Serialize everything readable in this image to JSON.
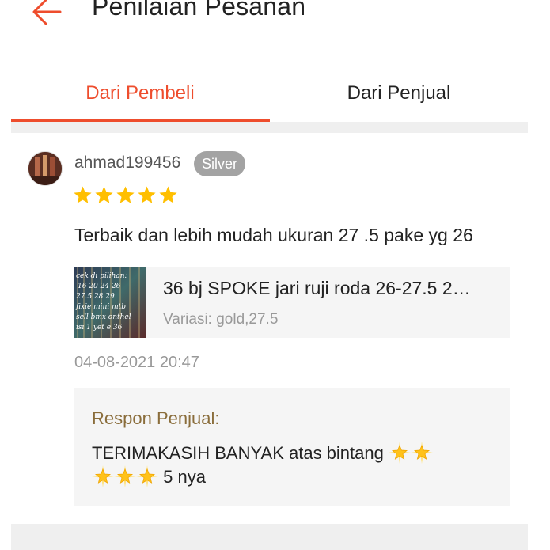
{
  "header": {
    "title": "Penilaian Pesanan",
    "back_icon": "arrow-left-icon",
    "accent": "#ee4d2d"
  },
  "tabs": [
    {
      "label": "Dari Pembeli",
      "active": true
    },
    {
      "label": "Dari Penjual",
      "active": false
    }
  ],
  "review": {
    "username": "ahmad199456",
    "badge": "Silver",
    "rating": 5,
    "star_color": "#ffbf00",
    "text": "Terbaik dan lebih mudah ukuran 27 .5 pake yg 26",
    "product": {
      "name": "36 bj SPOKE jari ruji roda 26-27.5 2…",
      "variant": "Variasi: gold,27.5",
      "thumb_text": [
        "cek di pilihan:",
        "16  20  24  26",
        "27.5  28  29",
        "fixie mini mtb",
        "sell bmx onthel",
        "isi 1 yet e 36"
      ]
    },
    "timestamp": "04-08-2021 20:47",
    "response": {
      "title": "Respon Penjual:",
      "text_before": "TERIMAKASIH BANYAK atas bintang",
      "text_after": "5 nya",
      "emoji_icon": "star-sparkle-icon",
      "emoji_count": 5
    }
  }
}
